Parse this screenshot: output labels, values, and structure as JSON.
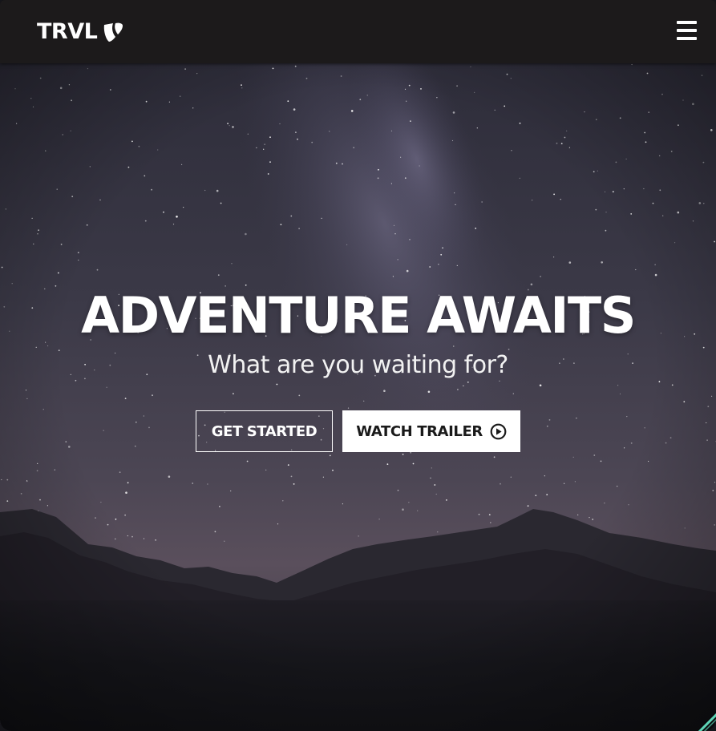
{
  "header": {
    "brand": "TRVL",
    "logo_icon": "typo3-icon",
    "menu_icon": "hamburger-menu-icon"
  },
  "hero": {
    "title": "ADVENTURE AWAITS",
    "subtitle": "What are you waiting for?",
    "primary_button": "GET STARTED",
    "secondary_button": "WATCH TRAILER",
    "secondary_button_icon": "play-circle-icon"
  },
  "colors": {
    "navbar": "#1c1a1b",
    "text": "#ffffff",
    "solid_button_bg": "#ffffff",
    "solid_button_text": "#1a1a1a",
    "accent": "#5ed6b8"
  }
}
